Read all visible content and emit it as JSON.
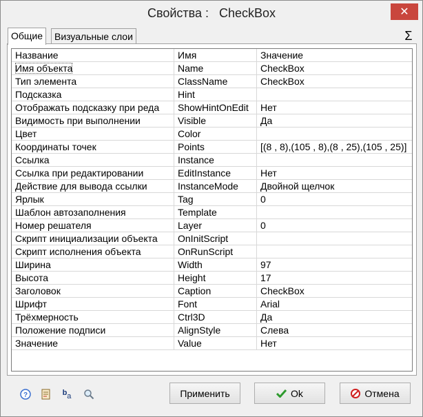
{
  "window": {
    "title": "Свойства :   CheckBox",
    "close_glyph": "✕"
  },
  "tabs": [
    {
      "label": "Общие",
      "active": true
    },
    {
      "label": "Визуальные слои",
      "active": false
    }
  ],
  "sigma_glyph": "Σ",
  "table": {
    "headers": [
      "Название",
      "Имя",
      "Значение"
    ],
    "rows": [
      {
        "name": "Имя объекта",
        "id": "Name",
        "value": "CheckBox"
      },
      {
        "name": "Тип элемента",
        "id": "ClassName",
        "value": "CheckBox"
      },
      {
        "name": "Подсказка",
        "id": "Hint",
        "value": ""
      },
      {
        "name": "Отображать подсказку при реда",
        "id": "ShowHintOnEdit",
        "value": "Нет"
      },
      {
        "name": "Видимость при выполнении",
        "id": "Visible",
        "value": "Да"
      },
      {
        "name": "Цвет",
        "id": "Color",
        "value": ""
      },
      {
        "name": "Координаты точек",
        "id": "Points",
        "value": "[(8 , 8),(105 , 8),(8 , 25),(105 , 25)]"
      },
      {
        "name": "Ссылка",
        "id": "Instance",
        "value": ""
      },
      {
        "name": "Ссылка при редактировании",
        "id": "EditInstance",
        "value": "Нет"
      },
      {
        "name": "Действие для вывода ссылки",
        "id": "InstanceMode",
        "value": "Двойной щелчок"
      },
      {
        "name": "Ярлык",
        "id": "Tag",
        "value": "0"
      },
      {
        "name": "Шаблон автозаполнения",
        "id": "Template",
        "value": ""
      },
      {
        "name": "Номер решателя",
        "id": "Layer",
        "value": "0"
      },
      {
        "name": "Скрипт инициализации объекта",
        "id": "OnInitScript",
        "value": ""
      },
      {
        "name": "Скрипт исполнения объекта",
        "id": "OnRunScript",
        "value": ""
      },
      {
        "name": "Ширина",
        "id": "Width",
        "value": "97"
      },
      {
        "name": "Высота",
        "id": "Height",
        "value": "17"
      },
      {
        "name": "Заголовок",
        "id": "Caption",
        "value": "CheckBox"
      },
      {
        "name": "Шрифт",
        "id": "Font",
        "value": "Arial"
      },
      {
        "name": "Трёхмерность",
        "id": "Ctrl3D",
        "value": "Да"
      },
      {
        "name": "Положение подписи",
        "id": "AlignStyle",
        "value": "Слева"
      },
      {
        "name": "Значение",
        "id": "Value",
        "value": "Нет"
      }
    ]
  },
  "bottom_icons": [
    {
      "name": "help-icon",
      "glyph": "?"
    },
    {
      "name": "properties-icon",
      "glyph": "▤"
    },
    {
      "name": "rename-icon",
      "glyph": "ba"
    },
    {
      "name": "search-icon",
      "glyph": "⚲"
    }
  ],
  "buttons": {
    "apply": {
      "label": "Применить"
    },
    "ok": {
      "label": "Ok",
      "icon": "check-icon"
    },
    "cancel": {
      "label": "Отмена",
      "icon": "cancel-icon"
    }
  },
  "colors": {
    "close_bg": "#c9463d",
    "ok_check": "#2e9a2e",
    "cancel_red": "#d01f1f",
    "help_blue": "#3a6fd0"
  }
}
